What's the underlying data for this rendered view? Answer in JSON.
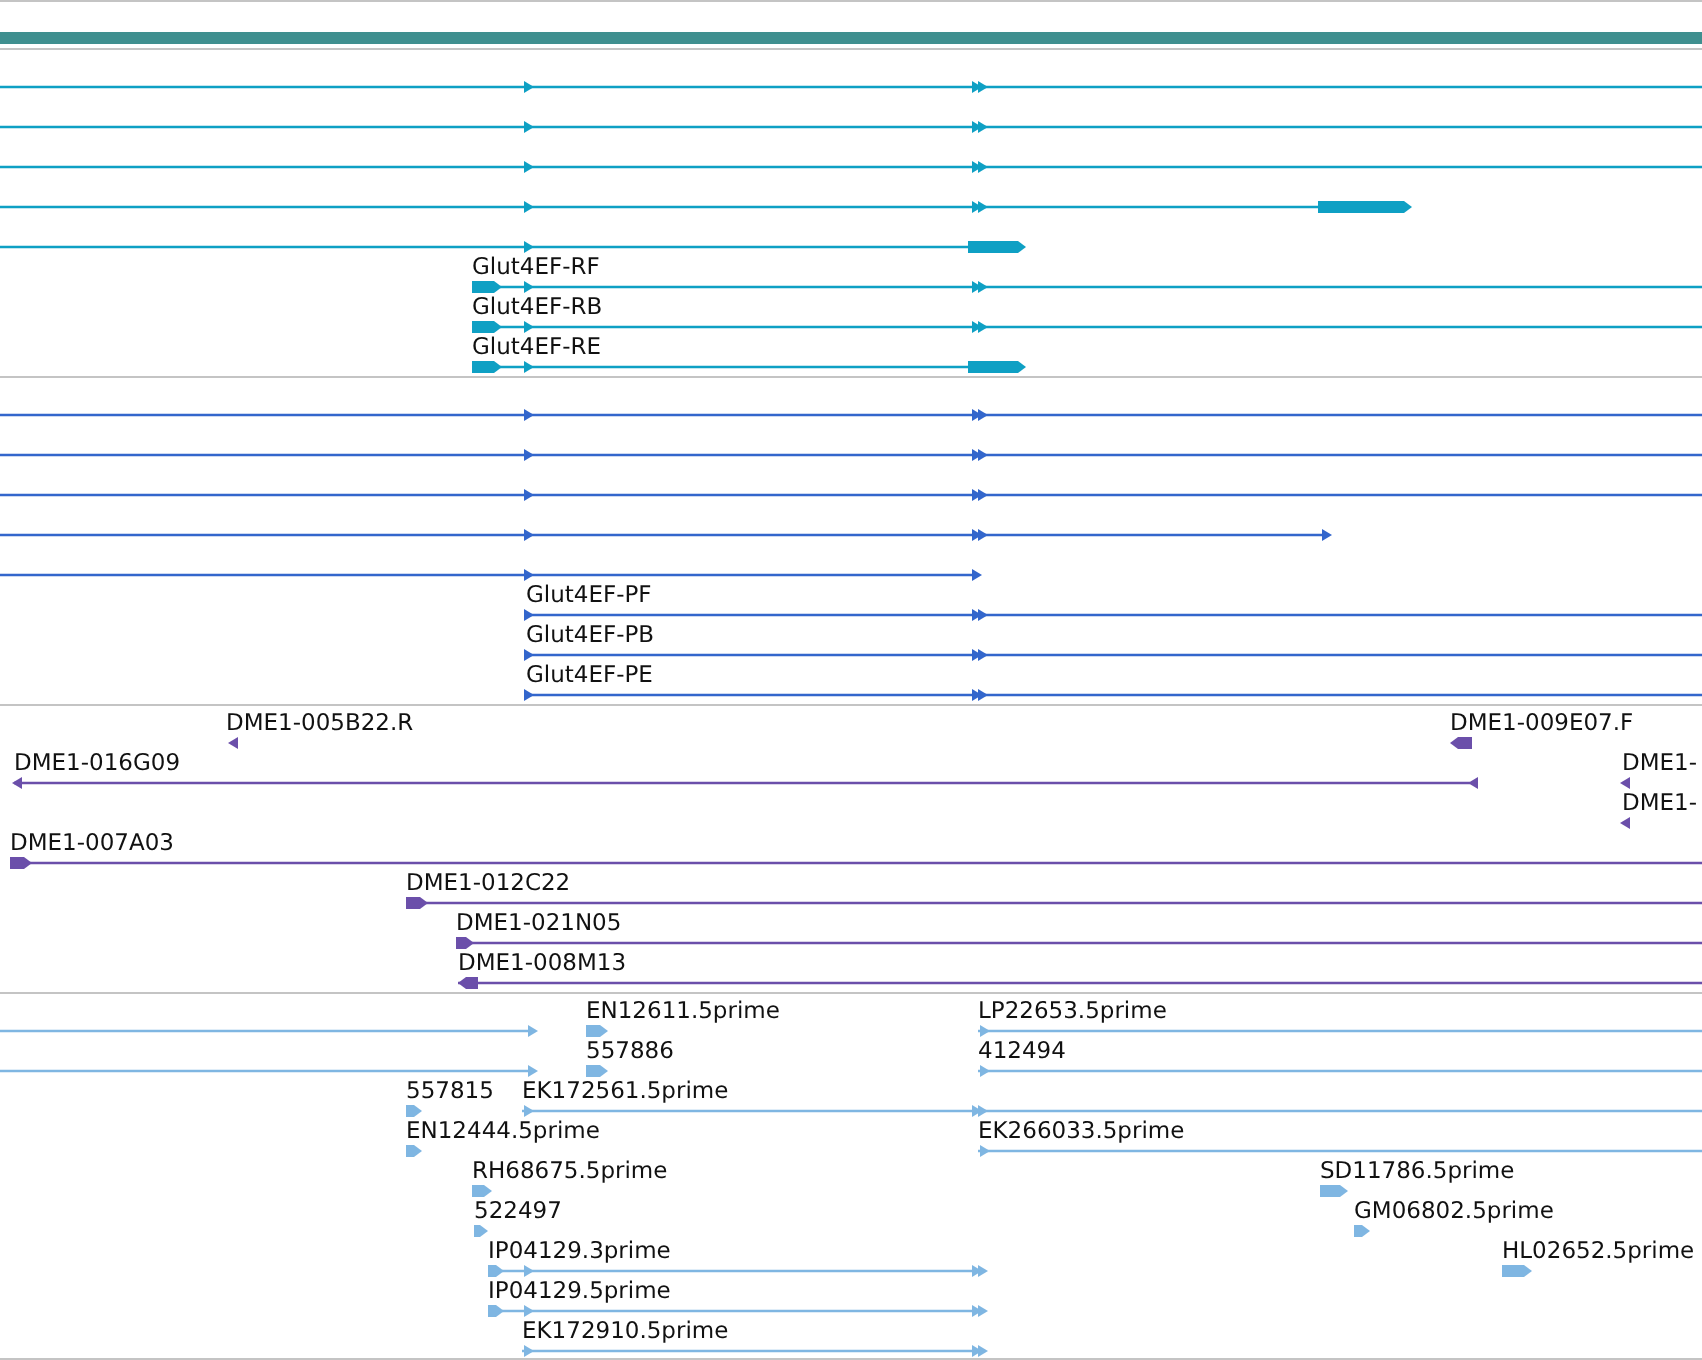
{
  "tracks": [
    {
      "color": "#0fa0c4",
      "labels": [
        "Glut4EF-RF",
        "Glut4EF-RB",
        "Glut4EF-RE"
      ]
    },
    {
      "color": "#3366cc",
      "labels": [
        "Glut4EF-PF",
        "Glut4EF-PB",
        "Glut4EF-PE"
      ]
    },
    {
      "color": "#6b4faa",
      "labels": [
        "DME1-005B22.R",
        "DME1-009E07.F",
        "DME1-016G09",
        "DME1-",
        "DME1-",
        "DME1-007A03",
        "DME1-012C22",
        "DME1-021N05",
        "DME1-008M13"
      ]
    },
    {
      "color": "#7fb6e2",
      "labels": [
        "EN12611.5prime",
        "LP22653.5prime",
        "557886",
        "412494",
        "557815",
        "EK172561.5prime",
        "EN12444.5prime",
        "EK266033.5prime",
        "RH68675.5prime",
        "SD11786.5prime",
        "522497",
        "GM06802.5prime",
        "IP04129.3prime",
        "HL02652.5prime",
        "IP04129.5prime",
        "EK172910.5prime"
      ]
    }
  ]
}
